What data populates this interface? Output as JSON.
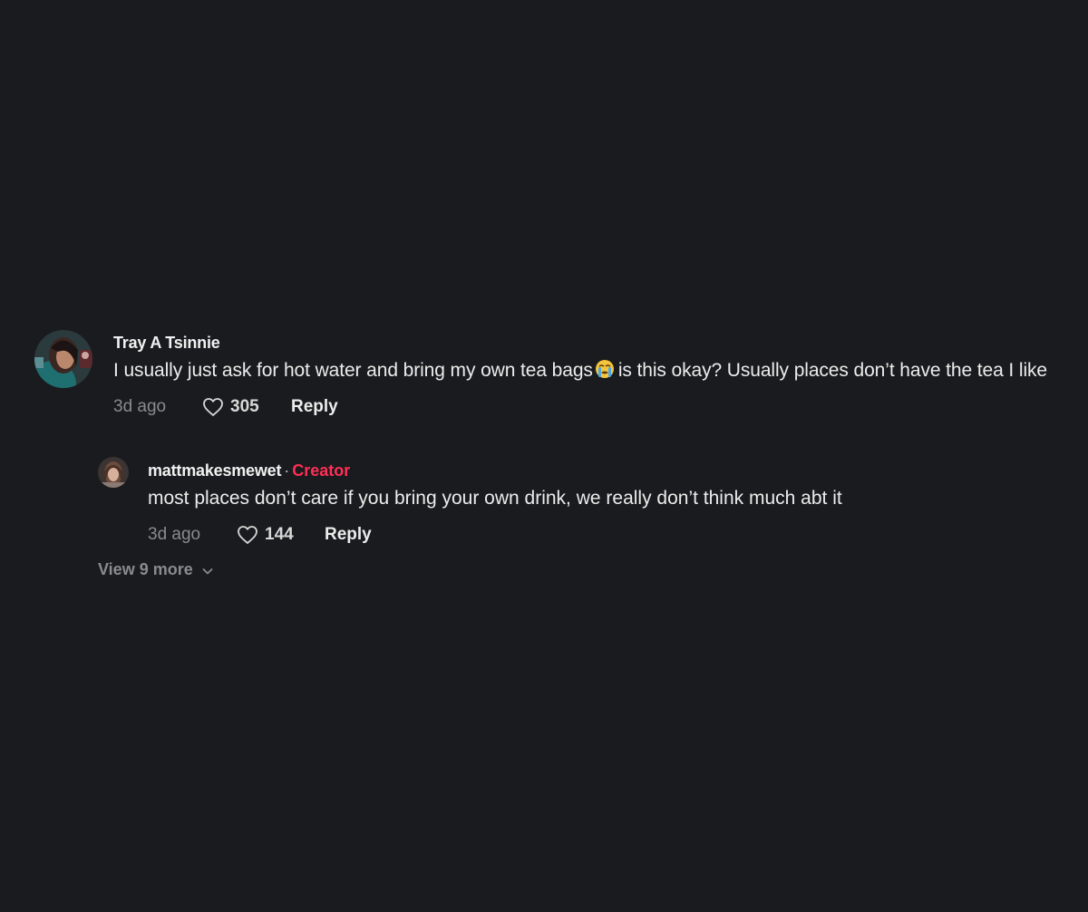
{
  "comment": {
    "username": "Tray A Tsinnie",
    "text_before_emoji": "I usually just ask for hot water and bring my own tea bags",
    "emoji_icon": "loudly-crying-face-icon",
    "text_after_emoji": "is this okay? Usually places don’t have the tea I like",
    "time": "3d ago",
    "likes": "305",
    "reply_label": "Reply"
  },
  "reply": {
    "username": "mattmakesmewet",
    "separator": "·",
    "badge": "Creator",
    "text": "most places don’t care if you bring your own drink, we really don’t think much abt it",
    "time": "3d ago",
    "likes": "144",
    "reply_label": "Reply"
  },
  "view_more": {
    "label": "View 9 more"
  },
  "colors": {
    "background": "#1a1b1e",
    "creator_badge": "#ff2f55",
    "muted_text": "#8a8b8f"
  }
}
